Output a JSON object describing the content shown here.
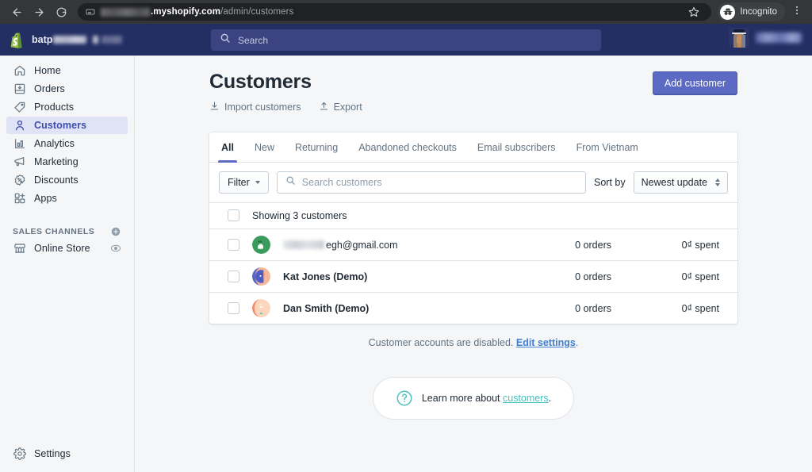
{
  "browser": {
    "back_icon": "back-arrow-icon",
    "forward_icon": "forward-arrow-icon",
    "reload_icon": "reload-icon",
    "url_domain": ".myshopify.com",
    "url_path": "/admin/customers",
    "star_icon": "bookmark-star-icon",
    "incognito_label": "Incognito",
    "menu_icon": "kebab-menu-icon"
  },
  "topbar": {
    "logo_icon": "shopify-bag-logo",
    "store_name": "batp",
    "search_placeholder": "Search",
    "search_icon": "search-icon"
  },
  "sidebar": {
    "items": [
      {
        "label": "Home",
        "icon": "home-icon",
        "active": false
      },
      {
        "label": "Orders",
        "icon": "orders-inbox-icon",
        "active": false
      },
      {
        "label": "Products",
        "icon": "products-tag-icon",
        "active": false
      },
      {
        "label": "Customers",
        "icon": "customers-person-icon",
        "active": true
      },
      {
        "label": "Analytics",
        "icon": "analytics-bar-chart-icon",
        "active": false
      },
      {
        "label": "Marketing",
        "icon": "marketing-megaphone-icon",
        "active": false
      },
      {
        "label": "Discounts",
        "icon": "discounts-percent-icon",
        "active": false
      },
      {
        "label": "Apps",
        "icon": "apps-grid-plus-icon",
        "active": false
      }
    ],
    "sales_channels_title": "SALES CHANNELS",
    "sales_channels_add_icon": "plus-circle-icon",
    "channels": [
      {
        "label": "Online Store",
        "icon": "storefront-icon",
        "action_icon": "eye-icon"
      }
    ],
    "settings": {
      "label": "Settings",
      "icon": "gear-icon"
    }
  },
  "page": {
    "title": "Customers",
    "import_label": "Import customers",
    "import_icon": "download-arrow-icon",
    "export_label": "Export",
    "export_icon": "upload-arrow-icon",
    "add_customer_label": "Add customer",
    "accent_color": "#5c6ac4"
  },
  "tabs": [
    {
      "label": "All",
      "active": true
    },
    {
      "label": "New",
      "active": false
    },
    {
      "label": "Returning",
      "active": false
    },
    {
      "label": "Abandoned checkouts",
      "active": false
    },
    {
      "label": "Email subscribers",
      "active": false
    },
    {
      "label": "From Vietnam",
      "active": false
    }
  ],
  "toolbar": {
    "filter_label": "Filter",
    "search_placeholder": "Search customers",
    "search_value": "",
    "search_icon": "search-icon",
    "sort_by_label": "Sort by",
    "sort_value": "Newest update",
    "sort_icon": "sort-updown-icon"
  },
  "list": {
    "showing_text": "Showing 3 customers",
    "select_all_checkbox": "unchecked",
    "rows": [
      {
        "name": "egh@gmail.com",
        "redacted": true,
        "orders": "0 orders",
        "spent": "0₫ spent",
        "avatar": "avatar-green"
      },
      {
        "name": "Kat Jones (Demo)",
        "redacted": false,
        "orders": "0 orders",
        "spent": "0₫ spent",
        "avatar": "avatar-blue"
      },
      {
        "name": "Dan Smith (Demo)",
        "redacted": false,
        "orders": "0 orders",
        "spent": "0₫ spent",
        "avatar": "avatar-peach"
      }
    ]
  },
  "footer": {
    "accounts_note": "Customer accounts are disabled.",
    "accounts_link": "Edit settings",
    "accounts_note_end": ".",
    "learn_more_prefix": "Learn more about ",
    "learn_more_link": "customers",
    "learn_more_suffix": ".",
    "help_icon": "question-circle-icon",
    "link_blue": "#3f7ed0",
    "link_teal": "#47c1bf"
  }
}
